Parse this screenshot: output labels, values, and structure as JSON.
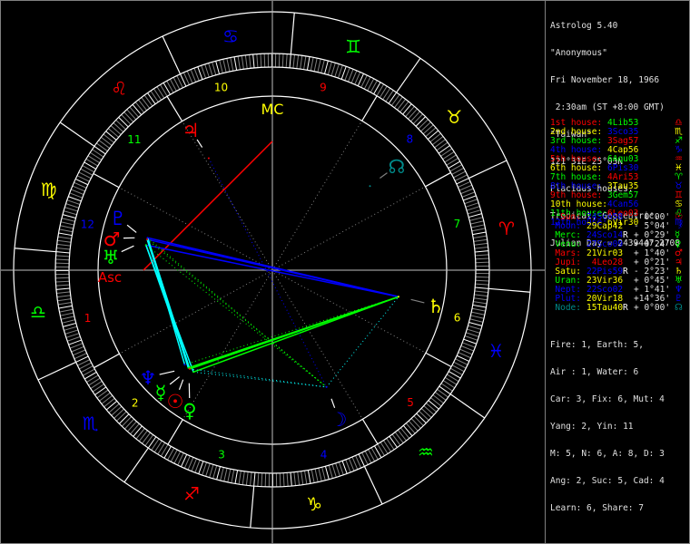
{
  "header": {
    "lines": [
      "Astrolog 5.40",
      "\"Anonymous\"",
      "Fri November 18, 1966",
      " 2:30am (ST +8:00 GMT)",
      "\"Taiwan\"",
      "121°31E 25°03N",
      "Placidus houses.",
      "Tropical, Geocentric.",
      "Julian Day = 2439447.2708"
    ]
  },
  "houses": [
    {
      "label": "1st house:",
      "cusp": "4Lib53",
      "lon": 184.88,
      "glyph": "♎",
      "color": "#ff0000",
      "cuspColor": "#00ff00"
    },
    {
      "label": "2nd house:",
      "cusp": "3Sco35",
      "lon": 213.58,
      "glyph": "♏",
      "color": "#ffff00",
      "cuspColor": "#0000ff"
    },
    {
      "label": "3rd house:",
      "cusp": "3Sag57",
      "lon": 243.95,
      "glyph": "♐",
      "color": "#00ff00",
      "cuspColor": "#ff0000"
    },
    {
      "label": "4th house:",
      "cusp": "4Cap56",
      "lon": 274.93,
      "glyph": "♑",
      "color": "#0000ff",
      "cuspColor": "#ffff00"
    },
    {
      "label": "5th house:",
      "cusp": "6Aqu03",
      "lon": 306.05,
      "glyph": "♒",
      "color": "#ff0000",
      "cuspColor": "#00ff00"
    },
    {
      "label": "6th house:",
      "cusp": "6Pis30",
      "lon": 336.5,
      "glyph": "♓",
      "color": "#ffff00",
      "cuspColor": "#0000ff"
    },
    {
      "label": "7th house:",
      "cusp": "4Ari53",
      "lon": 4.88,
      "glyph": "♈",
      "color": "#00ff00",
      "cuspColor": "#ff0000"
    },
    {
      "label": "8th house:",
      "cusp": "3Tau35",
      "lon": 33.58,
      "glyph": "♉",
      "color": "#0000ff",
      "cuspColor": "#ffff00"
    },
    {
      "label": "9th house:",
      "cusp": "3Gem57",
      "lon": 63.95,
      "glyph": "♊",
      "color": "#ff0000",
      "cuspColor": "#00ff00"
    },
    {
      "label": "10th house:",
      "cusp": "4Can56",
      "lon": 94.93,
      "glyph": "♋",
      "color": "#ffff00",
      "cuspColor": "#0000ff"
    },
    {
      "label": "11th house:",
      "cusp": "6Leo03",
      "lon": 126.05,
      "glyph": "♌",
      "color": "#00ff00",
      "cuspColor": "#ff0000"
    },
    {
      "label": "12th house:",
      "cusp": "6Vir30",
      "lon": 156.5,
      "glyph": "♍",
      "color": "#0000ff",
      "cuspColor": "#ffff00"
    }
  ],
  "house_numbers": [
    "1",
    "2",
    "3",
    "4",
    "5",
    "6",
    "7",
    "8",
    "9",
    "10",
    "11",
    "12"
  ],
  "planets": [
    {
      "key": "sun",
      "name": "Sun:",
      "pos": "24Sco58",
      "retro": "",
      "offset": "- 0°00'",
      "glyph": "☉",
      "lon": 234.97,
      "color": "#ff0000",
      "posColor": "#0000ff"
    },
    {
      "key": "moon",
      "name": "Moon:",
      "pos": "29Cap42",
      "retro": "",
      "offset": "- 5°04'",
      "glyph": "☽",
      "lon": 299.7,
      "color": "#0000ff",
      "posColor": "#ffff00"
    },
    {
      "key": "merc",
      "name": "Merc:",
      "pos": "24Sco14",
      "retro": "R",
      "offset": "+ 0°29'",
      "glyph": "☿",
      "lon": 234.23,
      "color": "#00ff00",
      "posColor": "#0000ff"
    },
    {
      "key": "venu",
      "name": "Venu:",
      "pos": "27Sco09",
      "retro": "",
      "offset": "+ 0°24'",
      "glyph": "♀",
      "lon": 237.15,
      "color": "#00ff00",
      "posColor": "#0000ff"
    },
    {
      "key": "mars",
      "name": "Mars:",
      "pos": "21Vir03",
      "retro": "",
      "offset": "+ 1°40'",
      "glyph": "♂",
      "lon": 171.05,
      "color": "#ff0000",
      "posColor": "#ffff00"
    },
    {
      "key": "jupi",
      "name": "Jupi:",
      "pos": " 4Leo28",
      "retro": "",
      "offset": "+ 0°21'",
      "glyph": "♃",
      "lon": 124.47,
      "color": "#ff0000",
      "posColor": "#ff0000"
    },
    {
      "key": "satu",
      "name": "Satu:",
      "pos": "22Pis59",
      "retro": "R",
      "offset": "- 2°23'",
      "glyph": "♄",
      "lon": 352.98,
      "color": "#ffff00",
      "posColor": "#0000ff"
    },
    {
      "key": "uran",
      "name": "Uran:",
      "pos": "23Vir36",
      "retro": "",
      "offset": "+ 0°45'",
      "glyph": "♅",
      "lon": 173.6,
      "color": "#00ff00",
      "posColor": "#ffff00"
    },
    {
      "key": "nept",
      "name": "Nept:",
      "pos": "22Sco02",
      "retro": "",
      "offset": "+ 1°41'",
      "glyph": "♆",
      "lon": 232.03,
      "color": "#0000ff",
      "posColor": "#0000ff"
    },
    {
      "key": "plut",
      "name": "Plut:",
      "pos": "20Vir18",
      "retro": "",
      "offset": "+14°36'",
      "glyph": "♇",
      "lon": 170.3,
      "color": "#0000ff",
      "posColor": "#ffff00"
    },
    {
      "key": "node",
      "name": "Node:",
      "pos": "15Tau40",
      "retro": "R",
      "offset": "+ 0°00'",
      "glyph": "☊",
      "lon": 45.67,
      "color": "#008b8b",
      "posColor": "#ffff00"
    }
  ],
  "angles": {
    "asc_label": "Asc",
    "asc_lon": 184.88,
    "mc_label": "MC",
    "mc_lon": 94.93
  },
  "signs": [
    {
      "glyph": "♈",
      "color": "#ff0000"
    },
    {
      "glyph": "♉",
      "color": "#ffff00"
    },
    {
      "glyph": "♊",
      "color": "#00ff00"
    },
    {
      "glyph": "♋",
      "color": "#0000ff"
    },
    {
      "glyph": "♌",
      "color": "#ff0000"
    },
    {
      "glyph": "♍",
      "color": "#ffff00"
    },
    {
      "glyph": "♎",
      "color": "#00ff00"
    },
    {
      "glyph": "♏",
      "color": "#0000ff"
    },
    {
      "glyph": "♐",
      "color": "#ff0000"
    },
    {
      "glyph": "♑",
      "color": "#ffff00"
    },
    {
      "glyph": "♒",
      "color": "#00ff00"
    },
    {
      "glyph": "♓",
      "color": "#0000ff"
    }
  ],
  "aspect_colors": {
    "conjunction": "#ffff00",
    "opposition": "#0000ff",
    "square": "#ff0000",
    "trine": "#00ff00",
    "sextile": "#00ffff"
  },
  "aspects": [
    {
      "a": "asc",
      "b": "mc",
      "type": "square",
      "tight": true
    },
    {
      "a": "mars",
      "b": "satu",
      "type": "opposition",
      "tight": true
    },
    {
      "a": "plut",
      "b": "satu",
      "type": "opposition",
      "tight": true
    },
    {
      "a": "uran",
      "b": "satu",
      "type": "opposition",
      "tight": true
    },
    {
      "a": "sun",
      "b": "mars",
      "type": "sextile",
      "tight": true
    },
    {
      "a": "sun",
      "b": "uran",
      "type": "sextile",
      "tight": true
    },
    {
      "a": "sun",
      "b": "plut",
      "type": "sextile",
      "tight": true
    },
    {
      "a": "merc",
      "b": "mars",
      "type": "sextile",
      "tight": true
    },
    {
      "a": "merc",
      "b": "plut",
      "type": "sextile",
      "tight": true
    },
    {
      "a": "venu",
      "b": "uran",
      "type": "sextile",
      "tight": true
    },
    {
      "a": "nept",
      "b": "plut",
      "type": "sextile",
      "tight": true
    },
    {
      "a": "sun",
      "b": "satu",
      "type": "trine",
      "tight": true
    },
    {
      "a": "merc",
      "b": "satu",
      "type": "trine",
      "tight": true
    },
    {
      "a": "venu",
      "b": "satu",
      "type": "trine",
      "tight": true
    },
    {
      "a": "sun",
      "b": "moon",
      "type": "sextile",
      "tight": false
    },
    {
      "a": "venu",
      "b": "moon",
      "type": "sextile",
      "tight": false
    },
    {
      "a": "jupi",
      "b": "moon",
      "type": "opposition",
      "tight": false
    },
    {
      "a": "mars",
      "b": "moon",
      "type": "trine",
      "tight": false
    },
    {
      "a": "uran",
      "b": "moon",
      "type": "trine",
      "tight": false
    },
    {
      "a": "moon",
      "b": "satu",
      "type": "sextile",
      "tight": false
    },
    {
      "a": "nept",
      "b": "satu",
      "type": "trine",
      "tight": false
    },
    {
      "a": "plut",
      "b": "moon",
      "type": "trine",
      "tight": false
    }
  ],
  "stats": [
    "Fire: 1, Earth: 5,",
    "Air : 1, Water: 6",
    "Car: 3, Fix: 6, Mut: 4",
    "Yang: 2, Yin: 11",
    "M: 5, N: 6, A: 8, D: 3",
    "Ang: 2, Suc: 5, Cad: 4",
    "Learn: 6, Share: 7"
  ]
}
